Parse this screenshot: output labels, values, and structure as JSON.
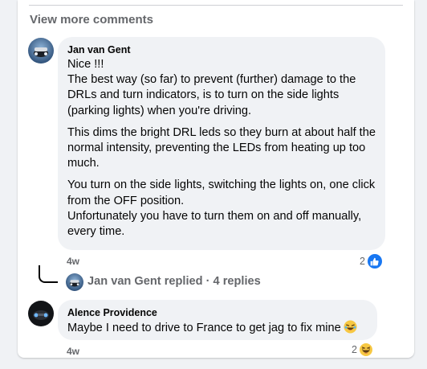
{
  "comments_section": {
    "view_more_label": "View more comments"
  },
  "comment1": {
    "author": "Jan van Gent",
    "paragraphs": [
      "Nice !!!\nThe best way (so far) to prevent (further) damage to the DRLs and turn indicators, is to turn on the side lights (parking lights) when you're driving.",
      "This dims the bright DRL leds so they burn at about half the normal intensity, preventing the LEDs from heating up too much.",
      "You turn on the side lights, switching the lights on, one click from the OFF position.\nUnfortunately you have to turn them on and off manually, every time."
    ],
    "time": "4w",
    "reaction_count": "2",
    "reaction_icon": "like-icon"
  },
  "replies": {
    "label": "Jan van Gent replied · 4 replies"
  },
  "comment2": {
    "author": "Alence Providence",
    "text": "Maybe I need to drive to France to get jag to fix mine",
    "emoji": "laughing-emoji",
    "time": "4w",
    "reaction_count": "2",
    "reaction_icon": "haha-icon"
  },
  "colors": {
    "bubble": "#f0f2f5",
    "secondary_text": "#65676b",
    "like_blue": "#1877f2"
  }
}
